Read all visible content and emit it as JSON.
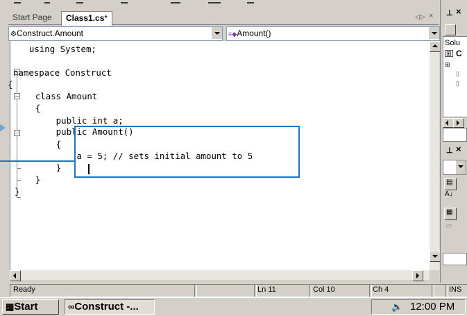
{
  "tabs": [
    {
      "label": "Start Page",
      "active": false
    },
    {
      "label": "Class1.cs",
      "modified_marker": "*",
      "active": true
    }
  ],
  "dropdowns": {
    "class_selector": "Construct.Amount",
    "member_selector": "Amount()"
  },
  "code_lines": [
    "  using System;",
    "",
    "namespace Construct",
    "{",
    "    class Amount",
    "    {",
    "        public int a;",
    "        public Amount()",
    "        {",
    "            a = 5; // sets initial amount to 5",
    "        }",
    "    }",
    "}"
  ],
  "right_panel": {
    "solution_label": "Solu",
    "c_label": "C"
  },
  "statusbar": {
    "ready": "Ready",
    "line": "Ln 11",
    "col": "Col 10",
    "ch": "Ch 4",
    "mode": "INS"
  },
  "taskbar": {
    "start": "Start",
    "task": "Construct -...",
    "clock": "12:00 PM"
  },
  "colors": {
    "highlight": "#1e73be",
    "background": "#d4d0c8"
  }
}
